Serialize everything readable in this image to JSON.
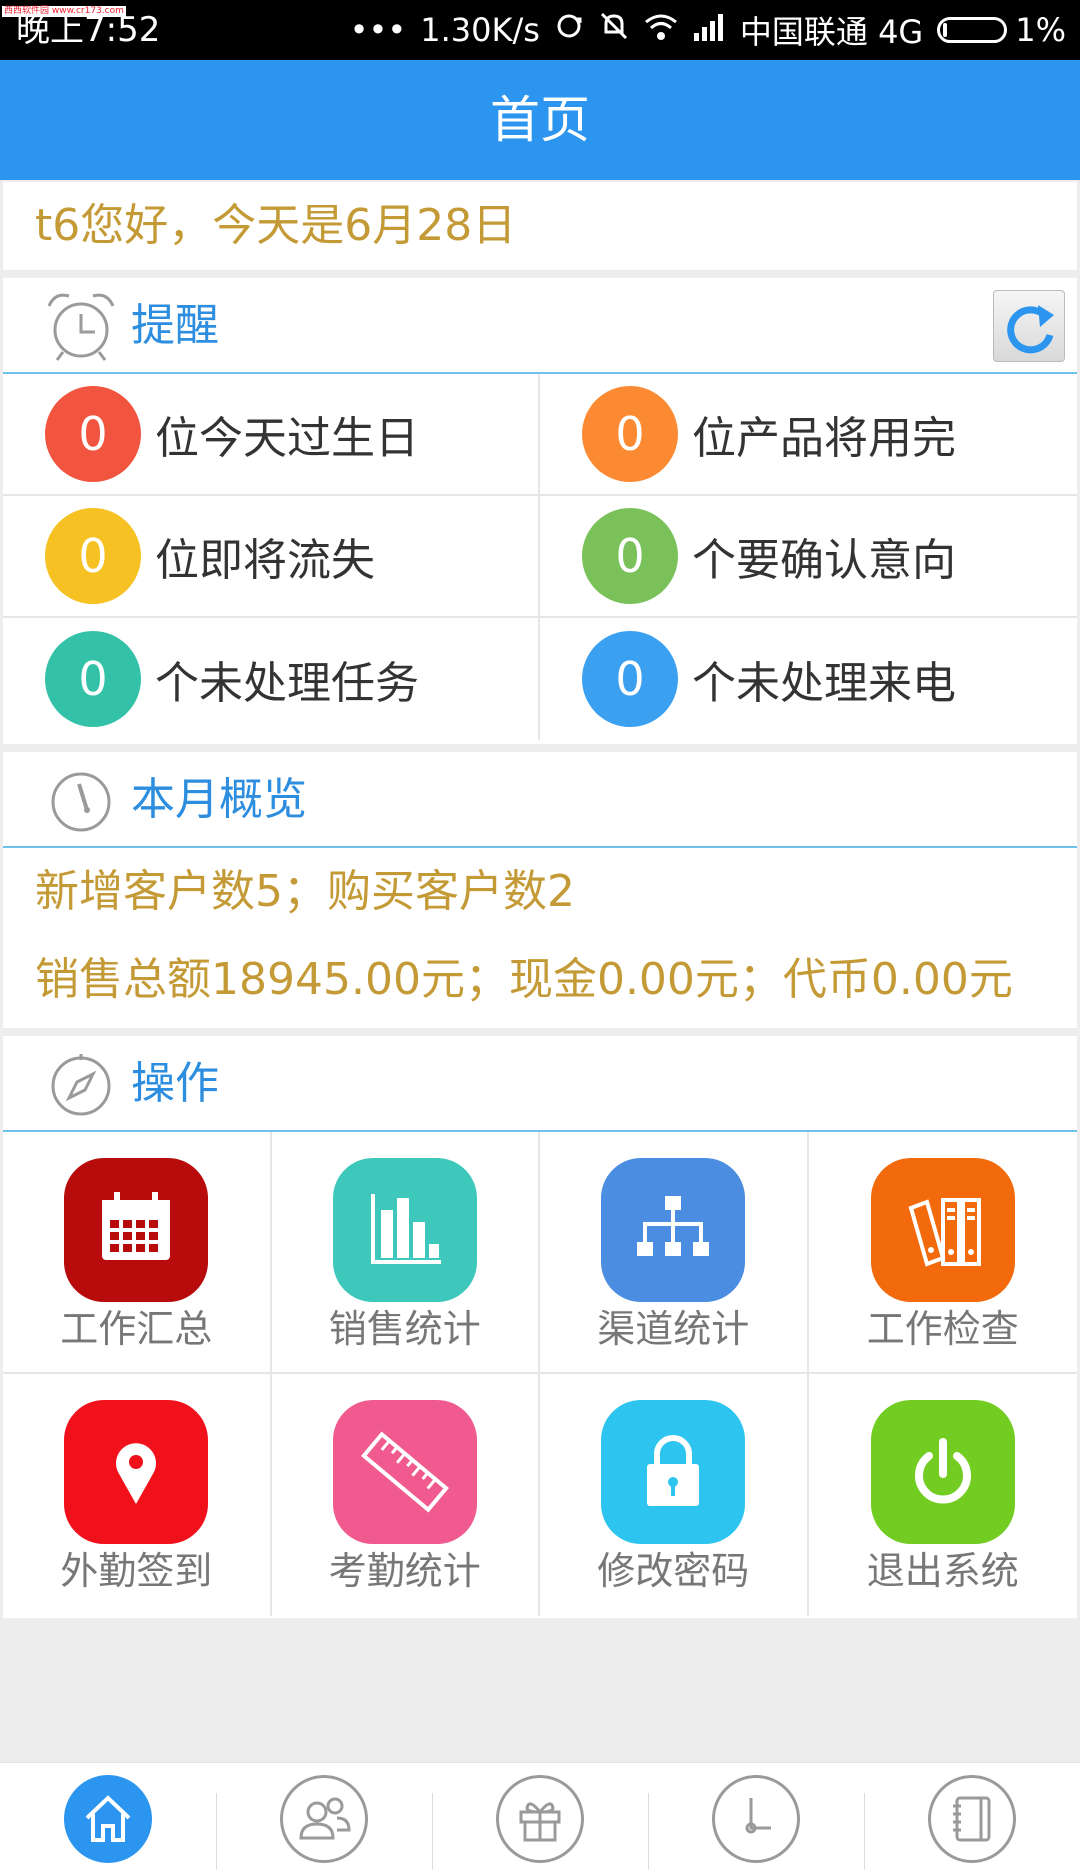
{
  "status_bar": {
    "time": "晚上7:52",
    "watermark": "西西软件园 www.cr173.com",
    "network_speed": "1.30K/s",
    "carrier": "中国联通 4G",
    "battery": "1%"
  },
  "header": {
    "title": "首页"
  },
  "greeting": "t6您好，今天是6月28日",
  "reminders": {
    "title": "提醒",
    "items": [
      {
        "count": "0",
        "label": "位今天过生日",
        "color": "#f2553f"
      },
      {
        "count": "0",
        "label": "位产品将用完",
        "color": "#fb8a32"
      },
      {
        "count": "0",
        "label": "位即将流失",
        "color": "#f6c223"
      },
      {
        "count": "0",
        "label": "个要确认意向",
        "color": "#7ac15a"
      },
      {
        "count": "0",
        "label": "个未处理任务",
        "color": "#33c2a7"
      },
      {
        "count": "0",
        "label": "个未处理来电",
        "color": "#3ca0f1"
      }
    ]
  },
  "overview": {
    "title": "本月概览",
    "line1": "新增客户数5；购买客户数2",
    "line2": "销售总额18945.00元；现金0.00元；代币0.00元"
  },
  "operations": {
    "title": "操作",
    "items": [
      {
        "label": "工作汇总",
        "icon": "calendar-icon",
        "color": "#b80b0b"
      },
      {
        "label": "销售统计",
        "icon": "bar-chart-icon",
        "color": "#3ec8bc"
      },
      {
        "label": "渠道统计",
        "icon": "hierarchy-icon",
        "color": "#4b8de0"
      },
      {
        "label": "工作检查",
        "icon": "binders-icon",
        "color": "#f26a0c"
      },
      {
        "label": "外勤签到",
        "icon": "location-pin-icon",
        "color": "#f0111b"
      },
      {
        "label": "考勤统计",
        "icon": "ruler-icon",
        "color": "#f05a8e"
      },
      {
        "label": "修改密码",
        "icon": "lock-icon",
        "color": "#2ec4f0"
      },
      {
        "label": "退出系统",
        "icon": "power-icon",
        "color": "#72cc22"
      }
    ]
  },
  "bottom_nav": [
    {
      "icon": "home-icon",
      "active": true
    },
    {
      "icon": "contacts-icon",
      "active": false
    },
    {
      "icon": "gift-icon",
      "active": false
    },
    {
      "icon": "clock-icon",
      "active": false
    },
    {
      "icon": "notebook-icon",
      "active": false
    }
  ]
}
